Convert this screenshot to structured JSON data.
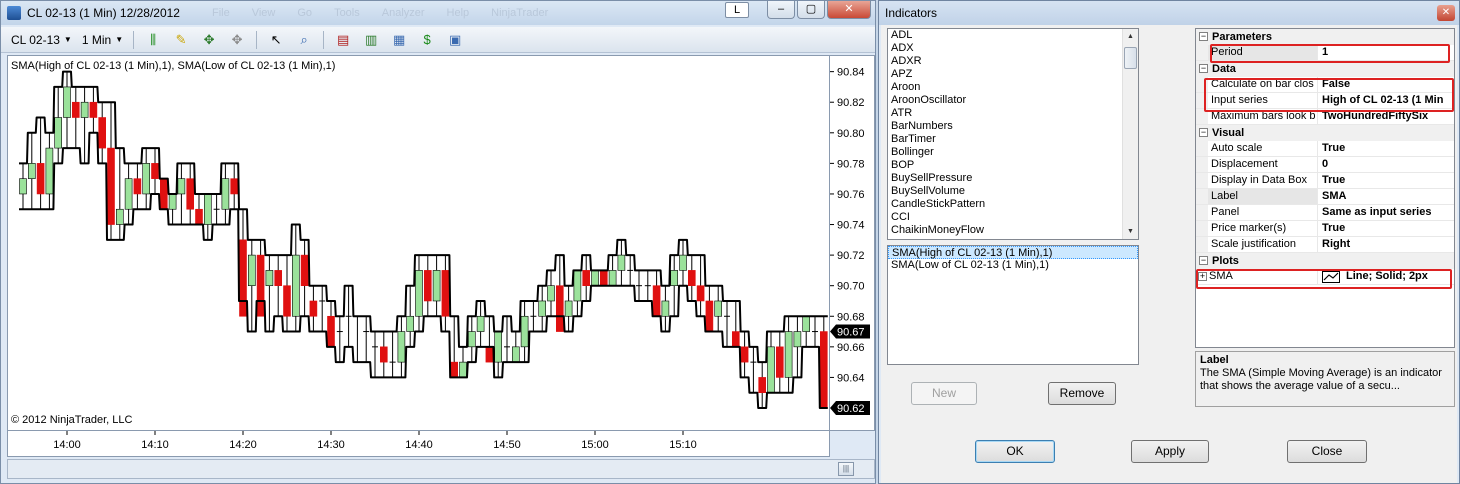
{
  "chart_window": {
    "title": "CL 02-13 (1 Min)  12/28/2012",
    "faded_menu": [
      "File",
      "View",
      "Go",
      "Tools",
      "Analyzer",
      "Help",
      "NinjaTrader"
    ],
    "controls": {
      "l": "L",
      "minimize": "–",
      "restore": "▢",
      "close": "✕"
    },
    "toolbar": {
      "instrument": "CL 02-13",
      "interval": "1 Min"
    },
    "legend": "SMA(High of CL 02-13 (1 Min),1), SMA(Low of CL 02-13 (1 Min),1)",
    "copyright": "© 2012 NinjaTrader, LLC",
    "current_high_label": "90.67",
    "current_low_label": "90.62"
  },
  "chart_data": {
    "type": "candlestick",
    "y_ticks": [
      "90.84",
      "90.82",
      "90.80",
      "90.78",
      "90.76",
      "90.74",
      "90.72",
      "90.70",
      "90.68",
      "90.66",
      "90.64"
    ],
    "ylim": [
      90.62,
      90.845
    ],
    "x_ticks": [
      "14:00",
      "14:10",
      "14:20",
      "14:30",
      "14:40",
      "14:50",
      "15:00",
      "15:10"
    ],
    "start_time": "13:55",
    "minutes_per_bar": 1,
    "series": [
      {
        "name": "SMA(High of CL 02-13 (1 Min),1)"
      },
      {
        "name": "SMA(Low of CL 02-13 (1 Min),1)"
      }
    ],
    "candles": [
      [
        90.76,
        90.78,
        90.75,
        90.77
      ],
      [
        90.77,
        90.8,
        90.75,
        90.78
      ],
      [
        90.78,
        90.81,
        90.75,
        90.76
      ],
      [
        90.76,
        90.8,
        90.75,
        90.79
      ],
      [
        90.79,
        90.83,
        90.78,
        90.81
      ],
      [
        90.81,
        90.84,
        90.79,
        90.83
      ],
      [
        90.82,
        90.83,
        90.79,
        90.81
      ],
      [
        90.81,
        90.83,
        90.78,
        90.82
      ],
      [
        90.82,
        90.83,
        90.8,
        90.81
      ],
      [
        90.81,
        90.82,
        90.78,
        90.79
      ],
      [
        90.79,
        90.82,
        90.73,
        90.74
      ],
      [
        90.74,
        90.79,
        90.73,
        90.75
      ],
      [
        90.75,
        90.78,
        90.74,
        90.77
      ],
      [
        90.77,
        90.78,
        90.75,
        90.76
      ],
      [
        90.76,
        90.79,
        90.75,
        90.78
      ],
      [
        90.78,
        90.79,
        90.76,
        90.77
      ],
      [
        90.77,
        90.77,
        90.75,
        90.75
      ],
      [
        90.75,
        90.76,
        90.74,
        90.76
      ],
      [
        90.76,
        90.78,
        90.74,
        90.77
      ],
      [
        90.77,
        90.78,
        90.74,
        90.75
      ],
      [
        90.75,
        90.76,
        90.74,
        90.74
      ],
      [
        90.74,
        90.76,
        90.73,
        90.76
      ],
      [
        90.75,
        90.76,
        90.74,
        90.75
      ],
      [
        90.75,
        90.78,
        90.74,
        90.77
      ],
      [
        90.77,
        90.78,
        90.75,
        90.76
      ],
      [
        90.73,
        90.75,
        90.69,
        90.68
      ],
      [
        90.7,
        90.73,
        90.67,
        90.72
      ],
      [
        90.72,
        90.73,
        90.69,
        90.68
      ],
      [
        90.7,
        90.72,
        90.67,
        90.71
      ],
      [
        90.71,
        90.72,
        90.68,
        90.7
      ],
      [
        90.7,
        90.72,
        90.67,
        90.68
      ],
      [
        90.68,
        90.74,
        90.67,
        90.72
      ],
      [
        90.72,
        90.73,
        90.68,
        90.7
      ],
      [
        90.69,
        90.7,
        90.67,
        90.68
      ],
      [
        90.69,
        90.7,
        90.67,
        90.69
      ],
      [
        90.68,
        90.69,
        90.66,
        90.66
      ],
      [
        90.67,
        90.68,
        90.65,
        90.67
      ],
      [
        90.68,
        90.7,
        90.66,
        90.68
      ],
      [
        90.68,
        90.68,
        90.65,
        90.68
      ],
      [
        90.67,
        90.68,
        90.65,
        90.67
      ],
      [
        90.66,
        90.67,
        90.64,
        90.66
      ],
      [
        90.66,
        90.67,
        90.64,
        90.65
      ],
      [
        90.65,
        90.67,
        90.64,
        90.65
      ],
      [
        90.65,
        90.68,
        90.64,
        90.67
      ],
      [
        90.67,
        90.7,
        90.66,
        90.68
      ],
      [
        90.68,
        90.72,
        90.67,
        90.71
      ],
      [
        90.71,
        90.72,
        90.68,
        90.69
      ],
      [
        90.69,
        90.72,
        90.68,
        90.71
      ],
      [
        90.71,
        90.72,
        90.67,
        90.68
      ],
      [
        90.65,
        90.68,
        90.64,
        90.64
      ],
      [
        90.64,
        90.66,
        90.64,
        90.65
      ],
      [
        90.66,
        90.68,
        90.65,
        90.67
      ],
      [
        90.67,
        90.69,
        90.66,
        90.68
      ],
      [
        90.66,
        90.68,
        90.66,
        90.65
      ],
      [
        90.65,
        90.67,
        90.64,
        90.67
      ],
      [
        90.66,
        90.68,
        90.65,
        90.66
      ],
      [
        90.65,
        90.67,
        90.65,
        90.66
      ],
      [
        90.66,
        90.69,
        90.65,
        90.68
      ],
      [
        90.68,
        90.69,
        90.67,
        90.68
      ],
      [
        90.68,
        90.7,
        90.67,
        90.69
      ],
      [
        90.69,
        90.71,
        90.68,
        90.7
      ],
      [
        90.7,
        90.72,
        90.68,
        90.67
      ],
      [
        90.68,
        90.7,
        90.67,
        90.69
      ],
      [
        90.69,
        90.71,
        90.68,
        90.71
      ],
      [
        90.71,
        90.72,
        90.69,
        90.7
      ],
      [
        90.7,
        90.71,
        90.7,
        90.71
      ],
      [
        90.71,
        90.71,
        90.7,
        90.7
      ],
      [
        90.7,
        90.72,
        90.7,
        90.71
      ],
      [
        90.71,
        90.73,
        90.7,
        90.72
      ],
      [
        90.71,
        90.72,
        90.7,
        90.71
      ],
      [
        90.7,
        90.71,
        90.69,
        90.7
      ],
      [
        90.7,
        90.71,
        90.69,
        90.7
      ],
      [
        90.7,
        90.71,
        90.68,
        90.68
      ],
      [
        90.68,
        90.7,
        90.67,
        90.69
      ],
      [
        90.7,
        90.72,
        90.68,
        90.71
      ],
      [
        90.71,
        90.73,
        90.7,
        90.72
      ],
      [
        90.71,
        90.72,
        90.69,
        90.7
      ],
      [
        90.7,
        90.72,
        90.68,
        90.69
      ],
      [
        90.69,
        90.7,
        90.67,
        90.67
      ],
      [
        90.68,
        90.7,
        90.67,
        90.69
      ],
      [
        90.68,
        90.69,
        90.66,
        90.68
      ],
      [
        90.67,
        90.69,
        90.66,
        90.66
      ],
      [
        90.66,
        90.67,
        90.64,
        90.65
      ],
      [
        90.65,
        90.66,
        90.63,
        90.65
      ],
      [
        90.64,
        90.65,
        90.62,
        90.63
      ],
      [
        90.63,
        90.67,
        90.63,
        90.66
      ],
      [
        90.66,
        90.67,
        90.63,
        90.64
      ],
      [
        90.64,
        90.68,
        90.63,
        90.67
      ],
      [
        90.66,
        90.68,
        90.64,
        90.67
      ],
      [
        90.67,
        90.68,
        90.66,
        90.68
      ],
      [
        90.67,
        90.68,
        90.66,
        90.67
      ],
      [
        90.67,
        90.68,
        90.62,
        90.62
      ]
    ]
  },
  "dialog": {
    "title": "Indicators",
    "close": "✕",
    "indicator_list": [
      "ADL",
      "ADX",
      "ADXR",
      "APZ",
      "Aroon",
      "AroonOscillator",
      "ATR",
      "BarNumbers",
      "BarTimer",
      "Bollinger",
      "BOP",
      "BuySellPressure",
      "BuySellVolume",
      "CandleStickPattern",
      "CCI",
      "ChaikinMoneyFlow"
    ],
    "applied": [
      "SMA(High of CL 02-13 (1 Min),1)",
      "SMA(Low of CL 02-13 (1 Min),1)"
    ],
    "buttons": {
      "new": "New",
      "remove": "Remove",
      "ok": "OK",
      "apply": "Apply",
      "close": "Close"
    },
    "properties": {
      "cat_parameters": "Parameters",
      "period_name": "Period",
      "period_value": "1",
      "cat_data": "Data",
      "calc_name": "Calculate on bar clos",
      "calc_value": "False",
      "input_name": "Input series",
      "input_value": "High of CL 02-13 (1 Min",
      "maxbars_name": "Maximum bars look b",
      "maxbars_value": "TwoHundredFiftySix",
      "cat_visual": "Visual",
      "autoscale_name": "Auto scale",
      "autoscale_value": "True",
      "displacement_name": "Displacement",
      "displacement_value": "0",
      "databox_name": "Display in Data Box",
      "databox_value": "True",
      "label_name": "Label",
      "label_value": "SMA",
      "panel_name": "Panel",
      "panel_value": "Same as input series",
      "pricemarker_name": "Price marker(s)",
      "pricemarker_value": "True",
      "scalejust_name": "Scale justification",
      "scalejust_value": "Right",
      "cat_plots": "Plots",
      "plot_name": "SMA",
      "plot_value": "Line; Solid; 2px"
    },
    "description": {
      "title": "Label",
      "text": "The SMA (Simple Moving Average) is an indicator that shows the average value of a secu..."
    }
  },
  "colors": {
    "up": "#9be29b",
    "down": "#e01010",
    "line": "#000000",
    "highlight": "#d22222"
  }
}
